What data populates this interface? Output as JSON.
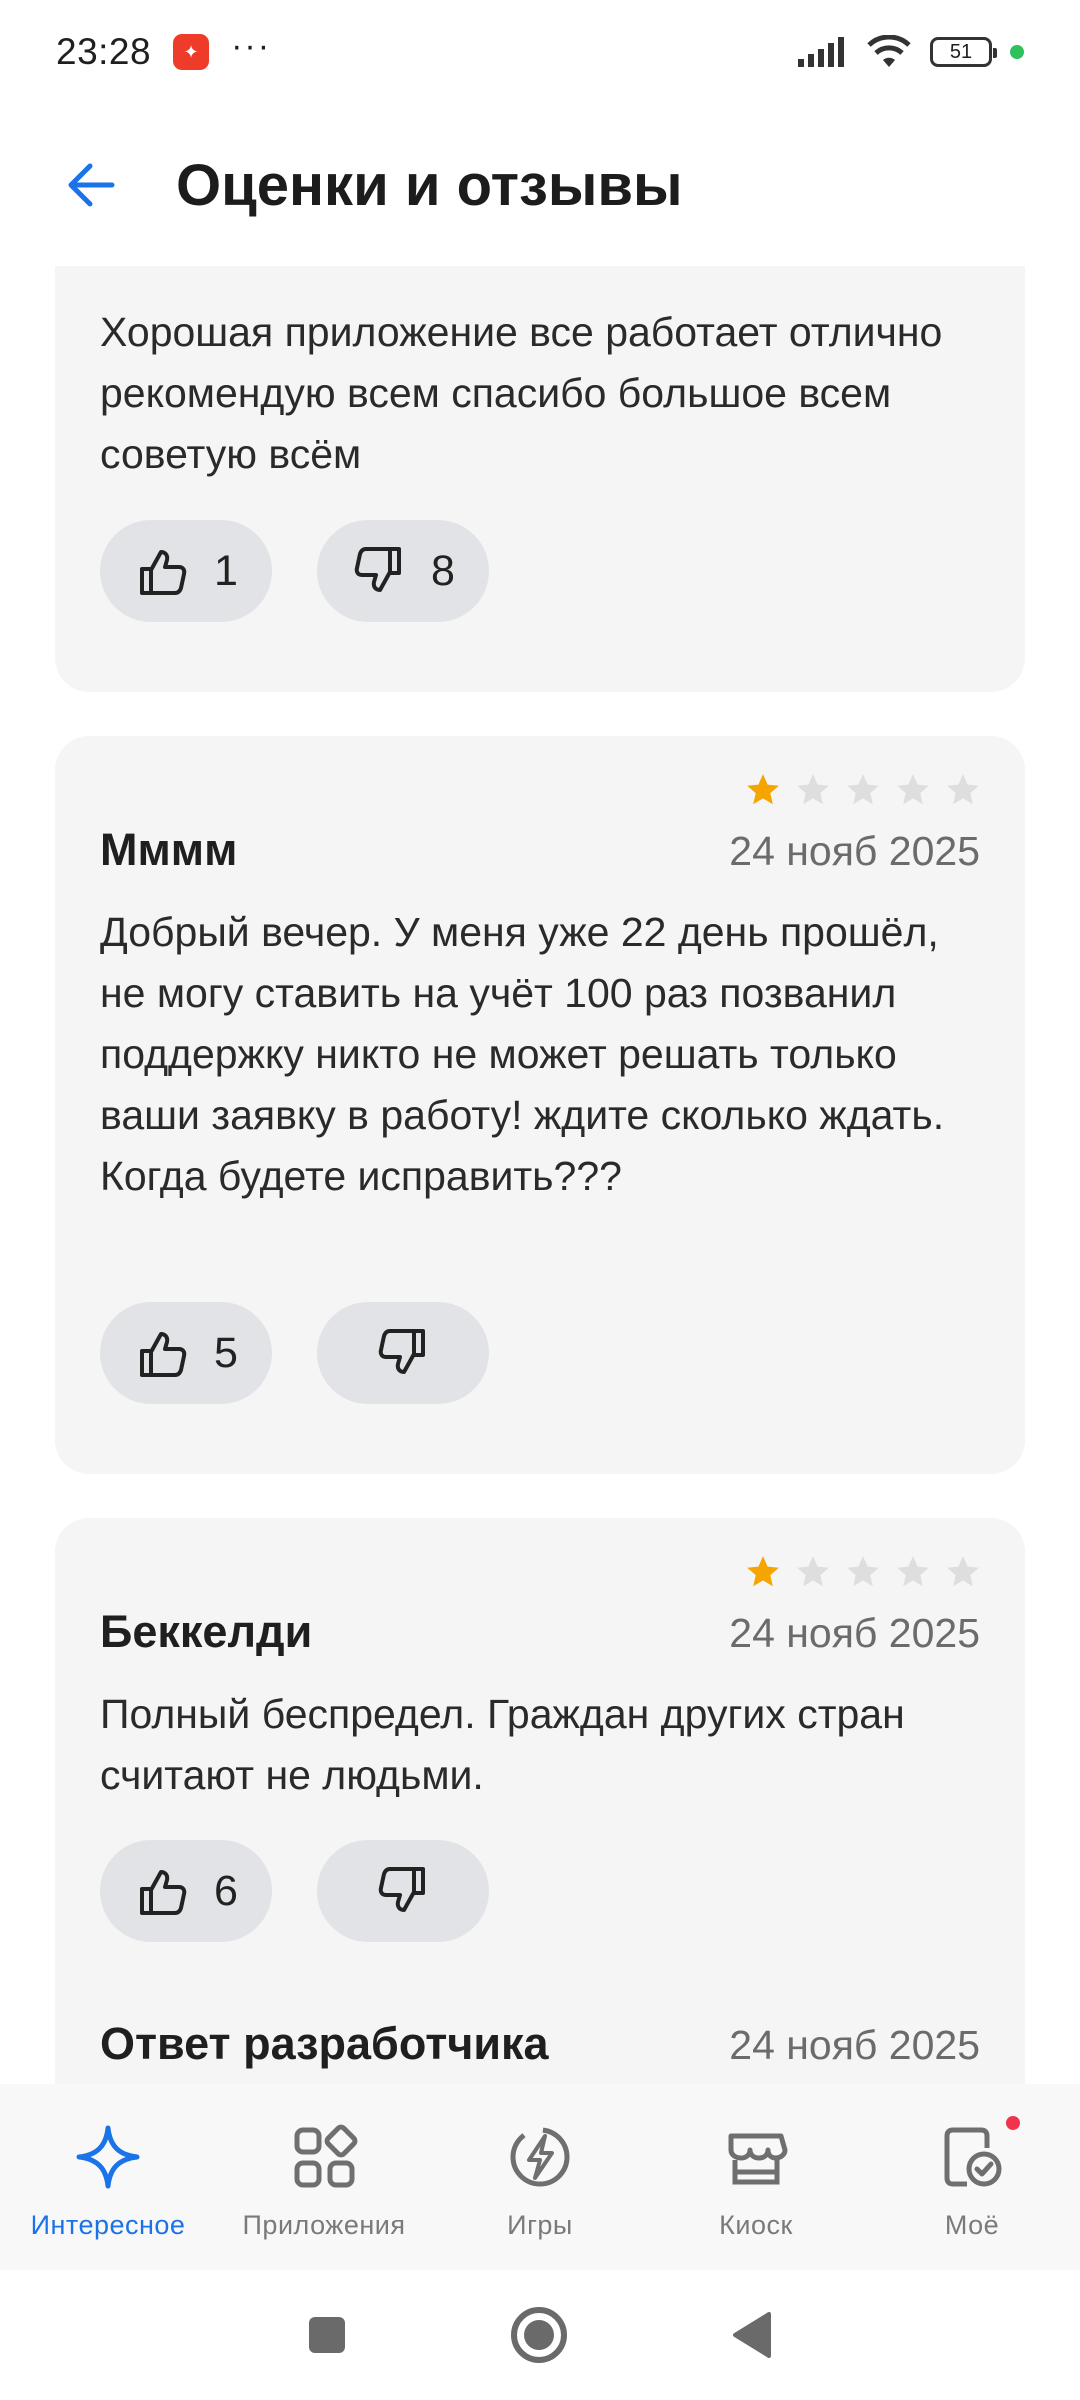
{
  "status_bar": {
    "time": "23:28",
    "more": "···",
    "battery": "51",
    "icons": [
      "signal-icon",
      "wifi-icon",
      "battery-icon"
    ]
  },
  "header": {
    "title": "Оценки и отзывы",
    "back_icon": "arrow-left-icon",
    "accent": "#1a73e8"
  },
  "reviews": [
    {
      "text": "Хорошая приложение все работает отлично рекомендую всем спасибо большое всем советую всём",
      "likes": "1",
      "dislikes": "8"
    },
    {
      "author": "Мммм",
      "date": "24 нояб 2025",
      "rating": 1,
      "text": "Добрый вечер. У меня уже 22 день прошёл, не могу ставить на учёт 100 раз позванил поддержку никто не может решать только ваши заявку в работу! ждите сколько ждать. Когда будете исправить???",
      "likes": "5",
      "dislikes": ""
    },
    {
      "author": "Беккелди",
      "date": "24 нояб 2025",
      "rating": 1,
      "text": "Полный беспредел. Граждан других стран считают не людьми.",
      "likes": "6",
      "dislikes": "",
      "developer_reply": {
        "label": "Ответ разработчика",
        "date": "24 нояб 2025"
      }
    }
  ],
  "bottom_nav": [
    {
      "label": "Интересное",
      "icon": "sparkle-icon",
      "active": true
    },
    {
      "label": "Приложения",
      "icon": "apps-grid-icon",
      "active": false
    },
    {
      "label": "Игры",
      "icon": "games-lightning-icon",
      "active": false
    },
    {
      "label": "Киоск",
      "icon": "kiosk-store-icon",
      "active": false
    },
    {
      "label": "Моё",
      "icon": "my-apps-icon",
      "active": false,
      "badge": true
    }
  ],
  "colors": {
    "star_filled": "#f5a400",
    "star_empty": "#dedede",
    "card_bg": "#f5f5f5",
    "vote_bg": "#e2e3e6"
  }
}
